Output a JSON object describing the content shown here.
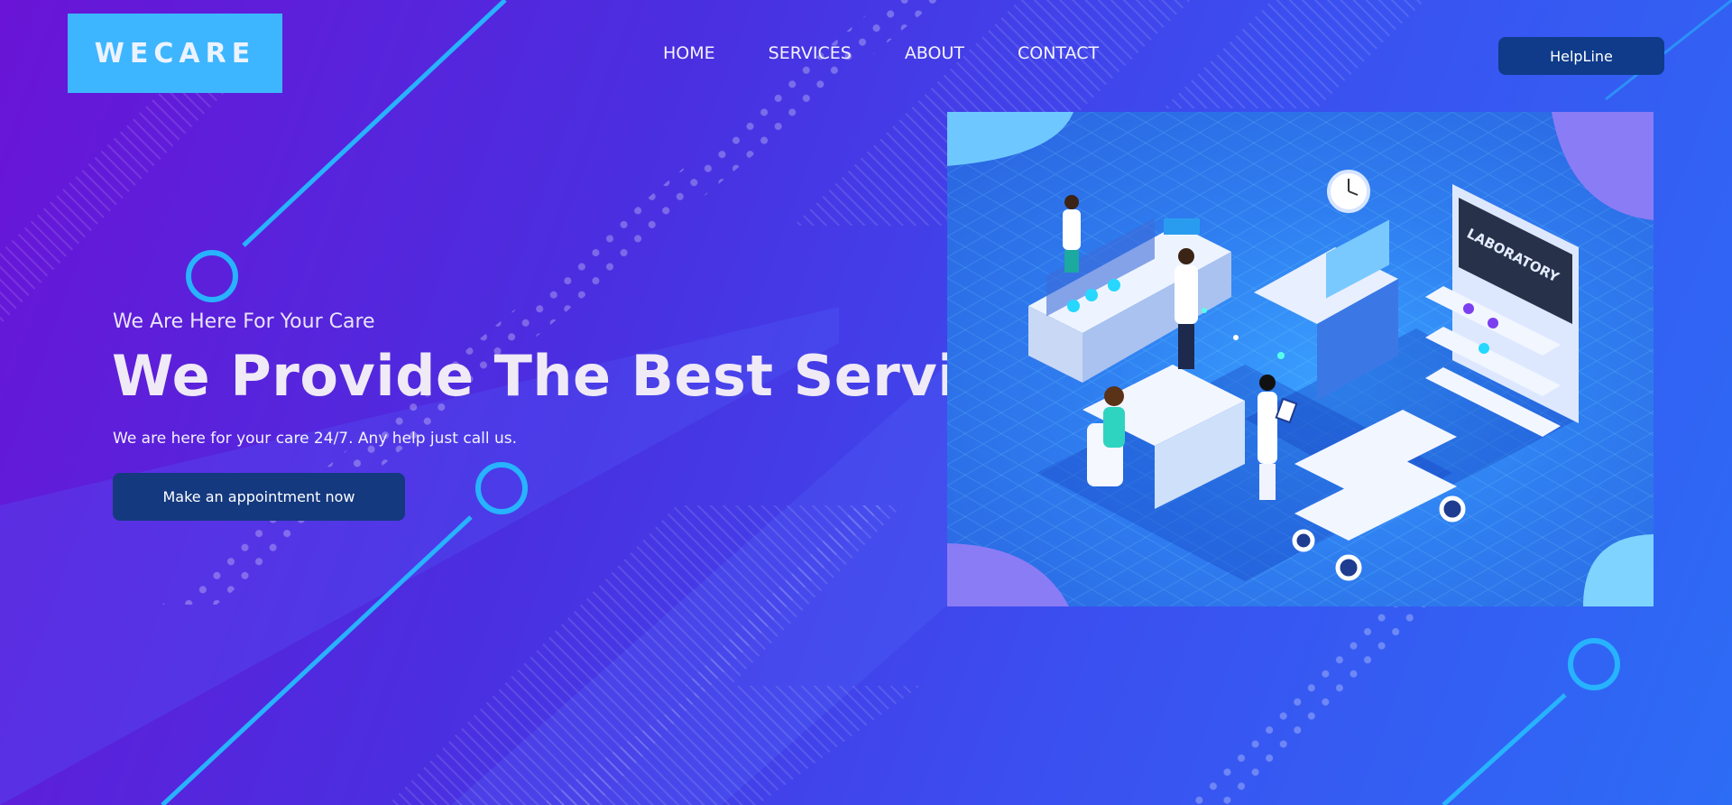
{
  "logo": {
    "text": "WECARE"
  },
  "nav": {
    "items": [
      {
        "label": "HOME"
      },
      {
        "label": "SERVICES"
      },
      {
        "label": "ABOUT"
      },
      {
        "label": "CONTACT"
      }
    ]
  },
  "header": {
    "helpline_label": "HelpLine"
  },
  "hero": {
    "kicker": "We Are Here For Your Care",
    "headline": "We Provide The Best Services",
    "subtext": "We are here for your care 24/7. Any help just call us.",
    "cta_label": "Make an appointment now"
  },
  "illustration": {
    "board_label": "LABORATORY"
  },
  "colors": {
    "logo_bg": "#3db6ff",
    "button_bg": "#0f3b8a",
    "accent_cyan": "#27b3ff"
  }
}
